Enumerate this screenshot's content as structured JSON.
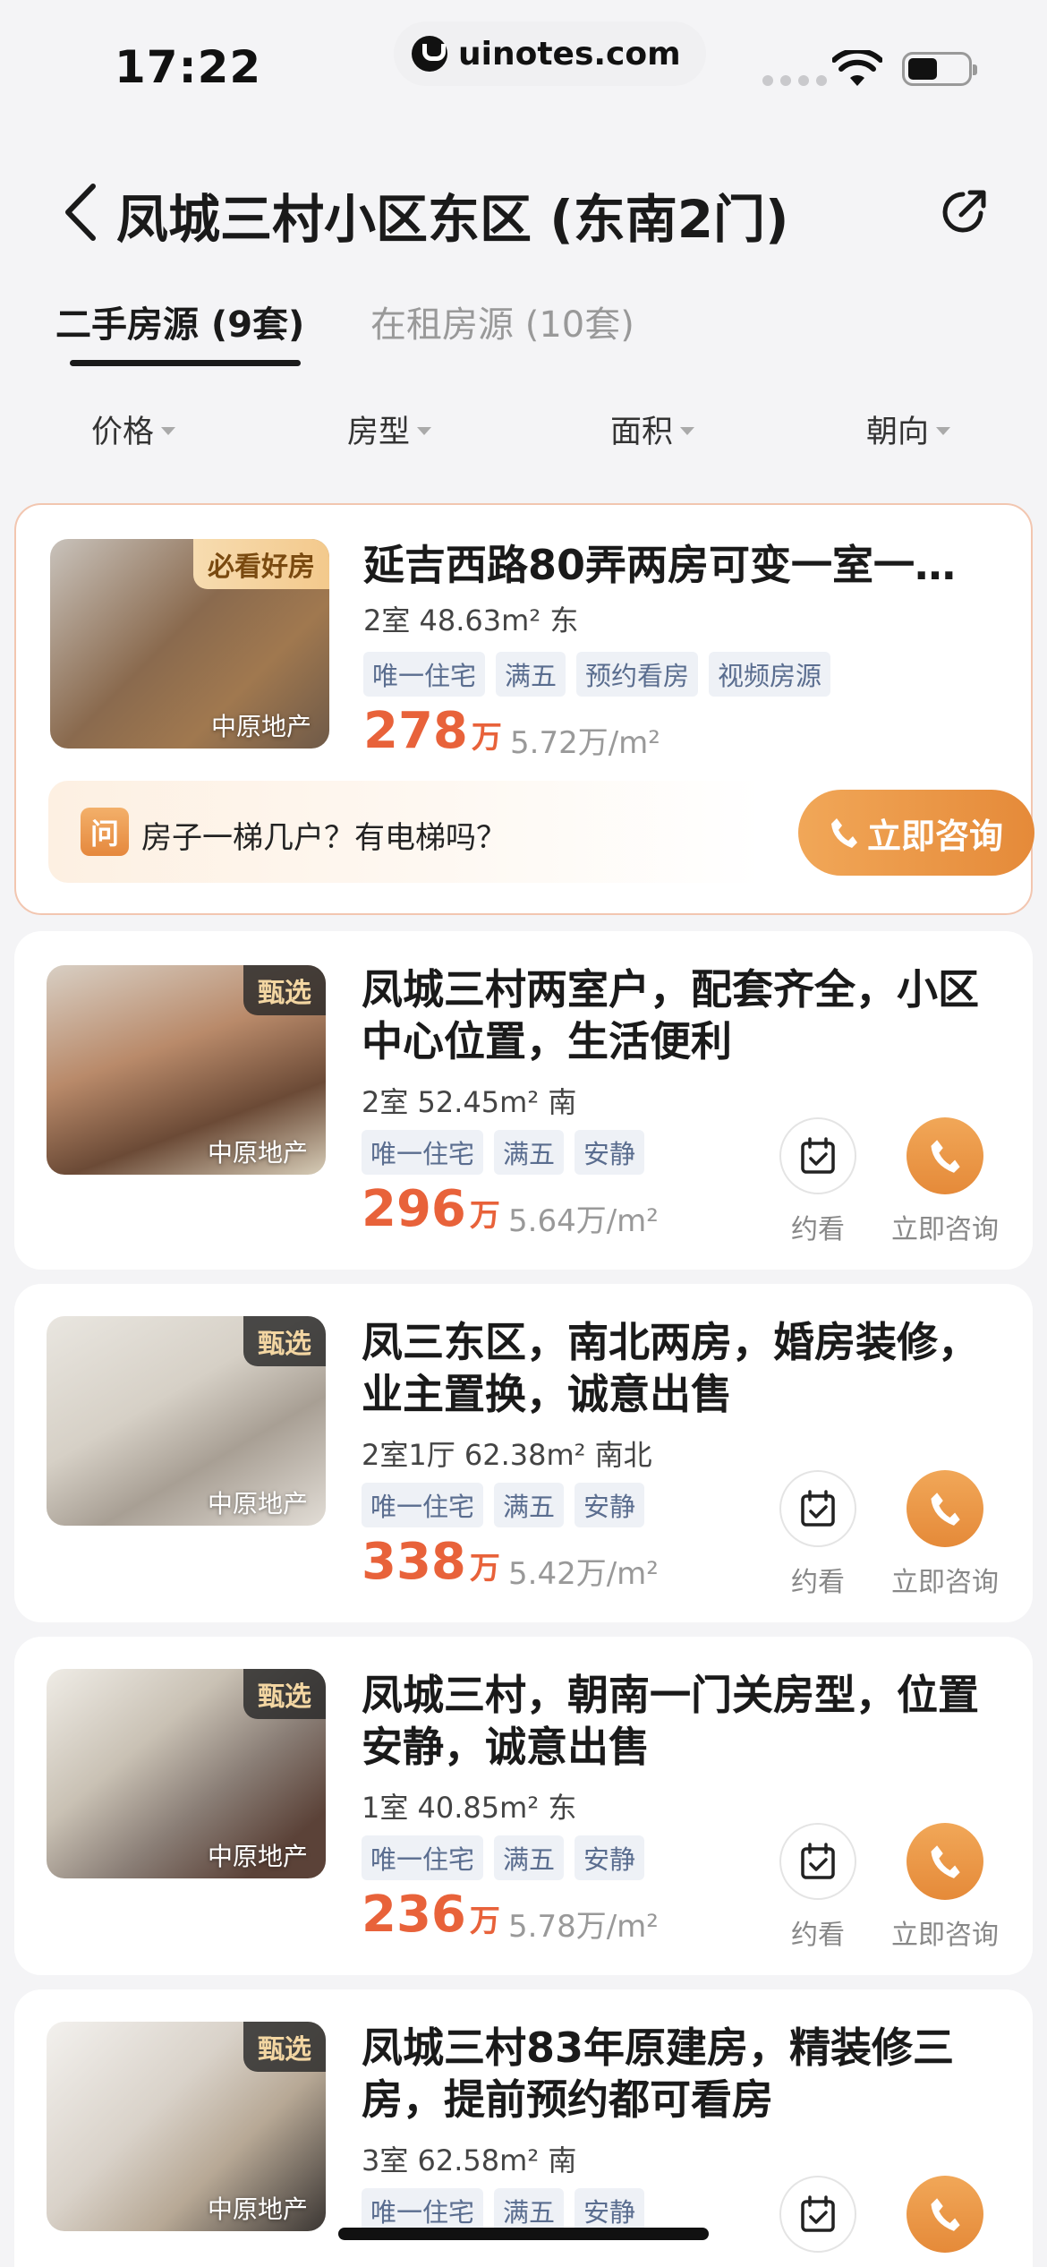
{
  "status_bar": {
    "time": "17:22",
    "url": "uinotes.com"
  },
  "header": {
    "title": "凤城三村小区东区 (东南2门)"
  },
  "tabs": [
    {
      "label": "二手房源 (9套)"
    },
    {
      "label": "在租房源 (10套)"
    }
  ],
  "filters": [
    {
      "label": "价格"
    },
    {
      "label": "房型"
    },
    {
      "label": "面积"
    },
    {
      "label": "朝向"
    }
  ],
  "featured": {
    "badge": "必看好房",
    "agency": "中原地产",
    "title": "延吉西路80弄两房可变一室一…",
    "spec": "2室  48.63m²  东",
    "tags": [
      "唯一住宅",
      "满五",
      "预约看房",
      "视频房源"
    ],
    "price": "278",
    "price_unit": "万",
    "unit_price": "5.72万/m²",
    "question_icon": "问",
    "question": "房子一梯几户？有电梯吗？",
    "consult_label": "立即咨询"
  },
  "listings": [
    {
      "badge": "甄选",
      "agency": "中原地产",
      "title": "凤城三村两室户，配套齐全，小区中心位置，生活便利",
      "spec": "2室  52.45m²  南",
      "tags": [
        "唯一住宅",
        "满五",
        "安静"
      ],
      "price": "296",
      "price_unit": "万",
      "unit_price": "5.64万/m²",
      "visit_label": "约看",
      "consult_label": "立即咨询"
    },
    {
      "badge": "甄选",
      "agency": "中原地产",
      "title": "凤三东区，南北两房，婚房装修，业主置换，诚意出售",
      "spec": "2室1厅  62.38m²  南北",
      "tags": [
        "唯一住宅",
        "满五",
        "安静"
      ],
      "price": "338",
      "price_unit": "万",
      "unit_price": "5.42万/m²",
      "visit_label": "约看",
      "consult_label": "立即咨询"
    },
    {
      "badge": "甄选",
      "agency": "中原地产",
      "title": "凤城三村，朝南一门关房型，位置安静，诚意出售",
      "spec": "1室  40.85m²  东",
      "tags": [
        "唯一住宅",
        "满五",
        "安静"
      ],
      "price": "236",
      "price_unit": "万",
      "unit_price": "5.78万/m²",
      "visit_label": "约看",
      "consult_label": "立即咨询"
    },
    {
      "badge": "甄选",
      "agency": "中原地产",
      "title": "凤城三村83年原建房，精装修三房，提前预约都可看房",
      "spec": "3室  62.58m²  南",
      "tags": [
        "唯一住宅",
        "满五",
        "安静"
      ]
    }
  ],
  "colors": {
    "accent": "#e8623a",
    "consult": "#e58a39"
  }
}
